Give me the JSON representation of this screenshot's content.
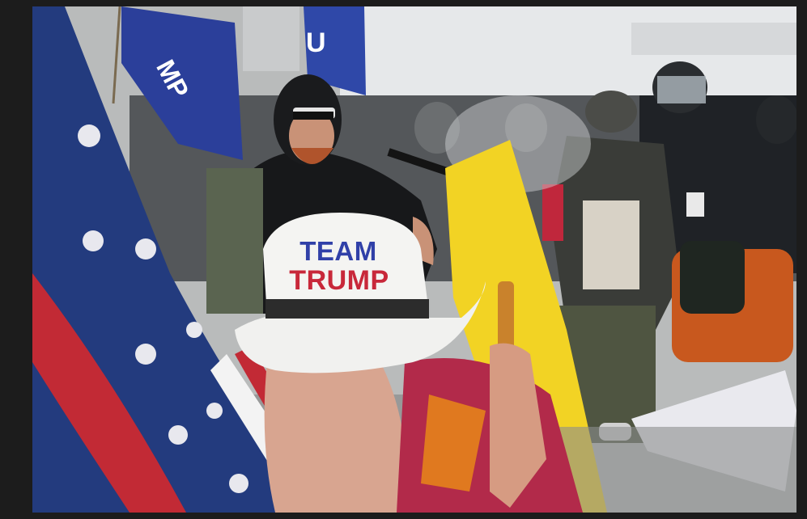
{
  "photo": {
    "hat_text": {
      "line1": "TEAM",
      "line2": "TRUMP"
    },
    "flag_text": {
      "left_flag": "MP",
      "right_flag": "U"
    },
    "colors": {
      "background": "#1c1c1c",
      "hat": "#f1f1ef",
      "hat_text_blue": "#3040a8",
      "hat_text_red": "#c8283a",
      "flag_blue": "#2b3f9a",
      "flag_yellow": "#f2d324",
      "sky": "#e9ecef"
    }
  }
}
